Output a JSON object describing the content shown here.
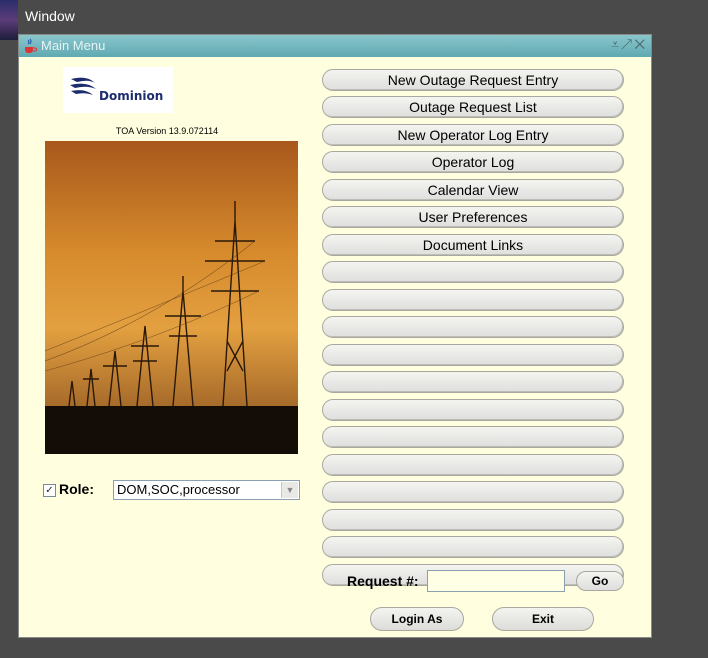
{
  "menubar": {
    "window_label": "Window"
  },
  "window": {
    "title": "Main Menu",
    "controls": [
      "minimize-icon",
      "maximize-icon",
      "close-icon"
    ]
  },
  "logo": {
    "text": "Dominion"
  },
  "version": "TOA Version 13.9.072114",
  "role": {
    "label": "Role:",
    "checked": true,
    "value": "DOM,SOC,processor"
  },
  "menu_buttons": [
    "New Outage Request Entry",
    "Outage Request List",
    "New Operator Log Entry",
    "Operator Log",
    "Calendar View",
    "User Preferences",
    "Document Links",
    "",
    "",
    "",
    "",
    "",
    "",
    "",
    "",
    "",
    "",
    "",
    ""
  ],
  "request": {
    "label": "Request #:",
    "value": "",
    "go_label": "Go"
  },
  "actions": {
    "login_label": "Login As",
    "exit_label": "Exit"
  },
  "colors": {
    "window_bg": "#ffffe0",
    "titlebar": "#6fb4bb",
    "desktop": "#4a4a4a"
  }
}
